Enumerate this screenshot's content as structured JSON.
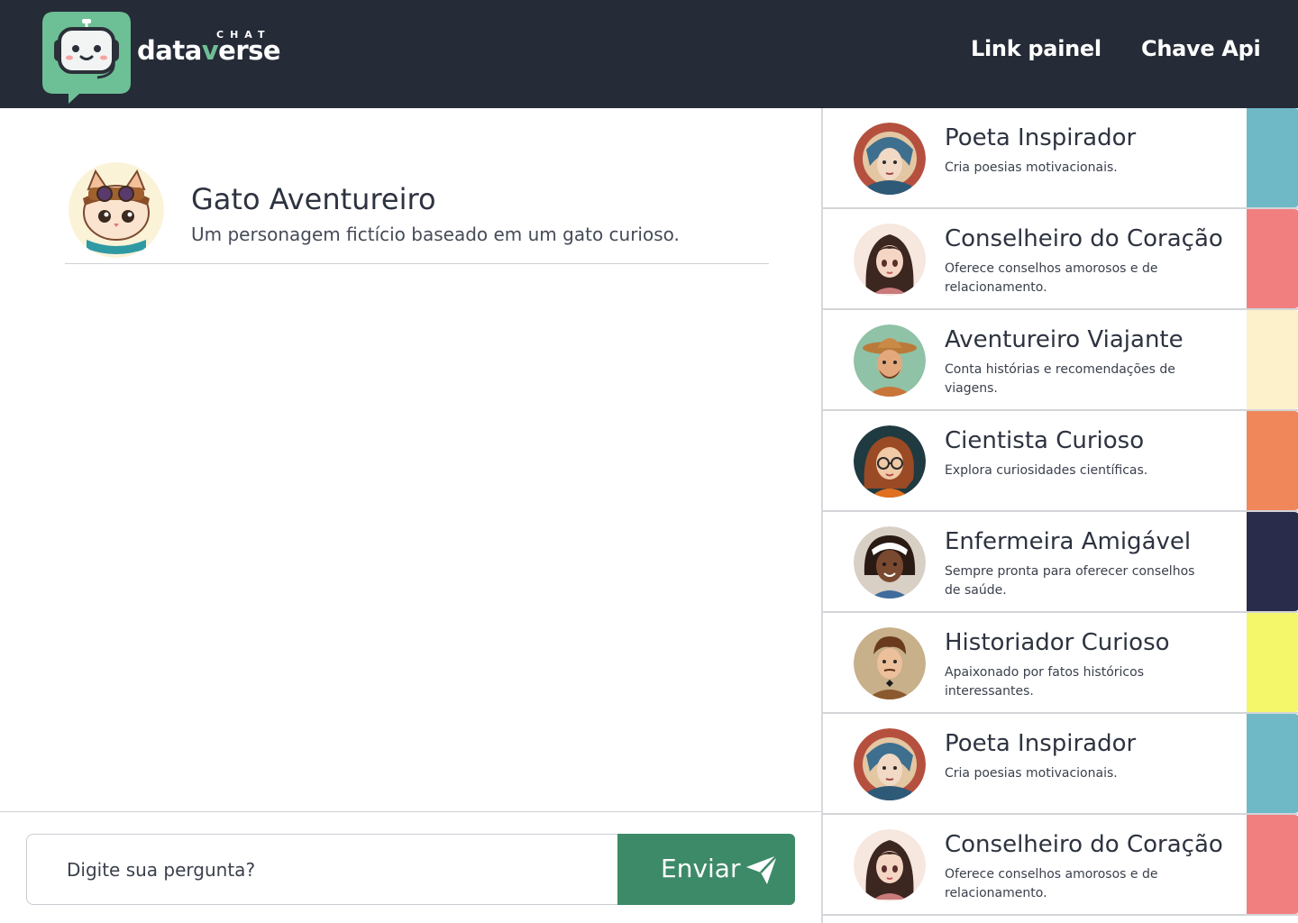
{
  "header": {
    "logo_small": "CHAT",
    "logo_word_a": "data",
    "logo_word_v": "v",
    "logo_word_b": "erse",
    "nav": [
      {
        "label": "Link painel"
      },
      {
        "label": "Chave Api"
      }
    ],
    "background": "#252b37",
    "logo_color": "#6dbf96"
  },
  "chat": {
    "persona": {
      "name": "Gato Aventureiro",
      "description": "Um personagem fictício baseado em um gato curioso.",
      "avatar_icon": "adventurer-cat-avatar"
    },
    "input": {
      "placeholder": "Digite sua pergunta?",
      "value": ""
    },
    "send_label": "Enviar",
    "send_icon": "paper-plane-icon",
    "send_color": "#3d8a68"
  },
  "sidebar": {
    "cards": [
      {
        "title": "Poeta Inspirador",
        "description": "Cria poesias motivacionais.",
        "color": "#6fb9c6",
        "avatar_icon": "poet-avatar"
      },
      {
        "title": "Conselheiro do Coração",
        "description": "Oferece conselhos amorosos e de relacionamento.",
        "color": "#f27f7f",
        "avatar_icon": "counselor-avatar"
      },
      {
        "title": "Aventureiro Viajante",
        "description": "Conta histórias e recomendações de viagens.",
        "color": "#fdf1cc",
        "avatar_icon": "traveler-avatar"
      },
      {
        "title": "Cientista Curioso",
        "description": "Explora curiosidades científicas.",
        "color": "#f0875b",
        "avatar_icon": "scientist-avatar"
      },
      {
        "title": "Enfermeira Amigável",
        "description": "Sempre pronta para oferecer conselhos de saúde.",
        "color": "#2a2c4b",
        "avatar_icon": "nurse-avatar"
      },
      {
        "title": "Historiador Curioso",
        "description": "Apaixonado por fatos históricos interessantes.",
        "color": "#f3f769",
        "avatar_icon": "historian-avatar"
      },
      {
        "title": "Poeta Inspirador",
        "description": "Cria poesias motivacionais.",
        "color": "#6fb9c6",
        "avatar_icon": "poet-avatar"
      },
      {
        "title": "Conselheiro do Coração",
        "description": "Oferece conselhos amorosos e de relacionamento.",
        "color": "#f27f7f",
        "avatar_icon": "counselor-avatar"
      }
    ]
  }
}
